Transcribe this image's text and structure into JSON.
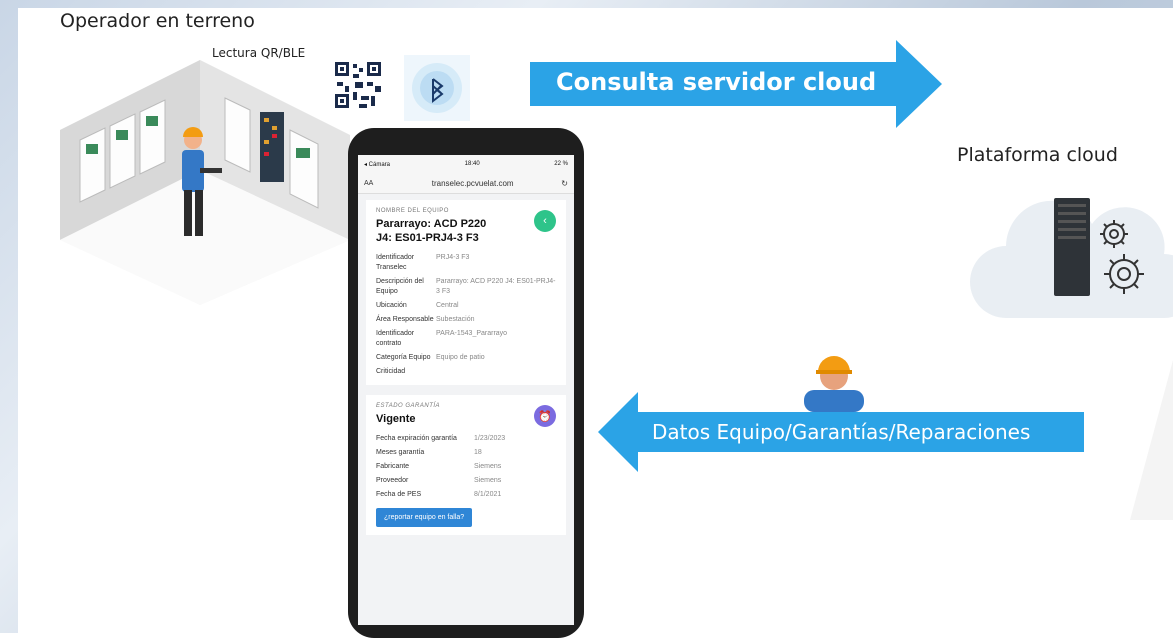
{
  "labels": {
    "operator": "Operador en terreno",
    "reading": "Lectura QR/BLE",
    "cloud": "Plataforma cloud"
  },
  "arrows": {
    "query": "Consulta servidor cloud",
    "data": "Datos Equipo/Garantías/Reparaciones"
  },
  "colors": {
    "arrow": "#2ba3e6",
    "green_btn": "#2ec48a",
    "purple_btn": "#7b6be0",
    "report_btn": "#2f86d6"
  },
  "icons": [
    "qr-code-icon",
    "bluetooth-icon",
    "server-icon",
    "gear-icon",
    "cloud-icon",
    "worker-icon"
  ],
  "phone": {
    "status": {
      "left": "◂ Cámara",
      "time": "18:40",
      "battery": "22 %"
    },
    "url": "transelec.pcvuelat.com",
    "aa": "AA",
    "equipment_card": {
      "header": "NOMBRE DEL EQUIPO",
      "title_line1": "Pararrayo: ACD P220",
      "title_line2": "J4: ES01-PRJ4-3 F3",
      "rows": [
        {
          "k": "Identificador Transelec",
          "v": "PRJ4-3 F3"
        },
        {
          "k": "Descripción del Equipo",
          "v": "Pararrayo: ACD P220 J4: ES01-PRJ4-3 F3"
        },
        {
          "k": "Ubicación",
          "v": "Central"
        },
        {
          "k": "Área Responsable",
          "v": "Subestación"
        },
        {
          "k": "Identificador contrato",
          "v": "PARA-1543_Pararrayo"
        },
        {
          "k": "Categoría Equipo",
          "v": "Equipo de patio"
        },
        {
          "k": "Criticidad",
          "v": ""
        }
      ]
    },
    "warranty_card": {
      "header": "ESTADO GARANTÍA",
      "title": "Vigente",
      "rows": [
        {
          "k": "Fecha expiración garantía",
          "v": "1/23/2023"
        },
        {
          "k": "Meses garantía",
          "v": "18"
        },
        {
          "k": "Fabricante",
          "v": "Siemens"
        },
        {
          "k": "Proveedor",
          "v": "Siemens"
        },
        {
          "k": "Fecha de PES",
          "v": "8/1/2021"
        }
      ],
      "button": "¿reportar equipo en falla?"
    }
  }
}
